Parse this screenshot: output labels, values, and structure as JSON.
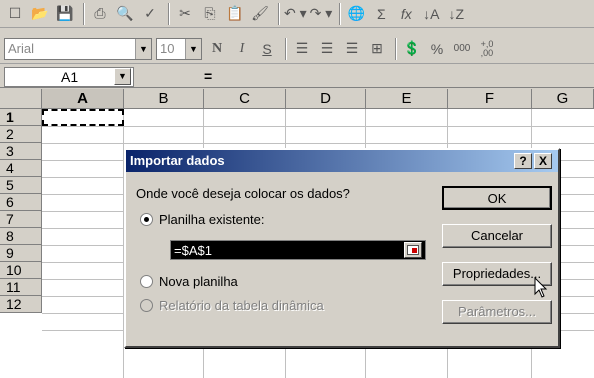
{
  "toolbar_formatting": {
    "font_name": "Arial",
    "font_size": "10",
    "bold": "N",
    "italic": "I",
    "underline": "S",
    "percent": "%",
    "thousands": "000",
    "increase_decimal": "+,0\n,00"
  },
  "formula_bar": {
    "name_box": "A1",
    "equals": "="
  },
  "grid": {
    "columns": [
      "A",
      "B",
      "C",
      "D",
      "E",
      "F",
      "G"
    ],
    "rows": [
      "1",
      "2",
      "3",
      "4",
      "5",
      "6",
      "7",
      "8",
      "9",
      "10",
      "11",
      "12"
    ],
    "active_cell": "A1"
  },
  "dialog": {
    "title": "Importar dados",
    "help_button": "?",
    "close_button": "X",
    "question": "Onde você deseja colocar os dados?",
    "option_existing": "Planilha existente:",
    "reference_value": "=$A$1",
    "option_new": "Nova planilha",
    "option_pivot": "Relatório da tabela dinâmica",
    "ok_label": "OK",
    "cancel_label": "Cancelar",
    "properties_label": "Propriedades...",
    "parameters_label": "Parâmetros..."
  }
}
